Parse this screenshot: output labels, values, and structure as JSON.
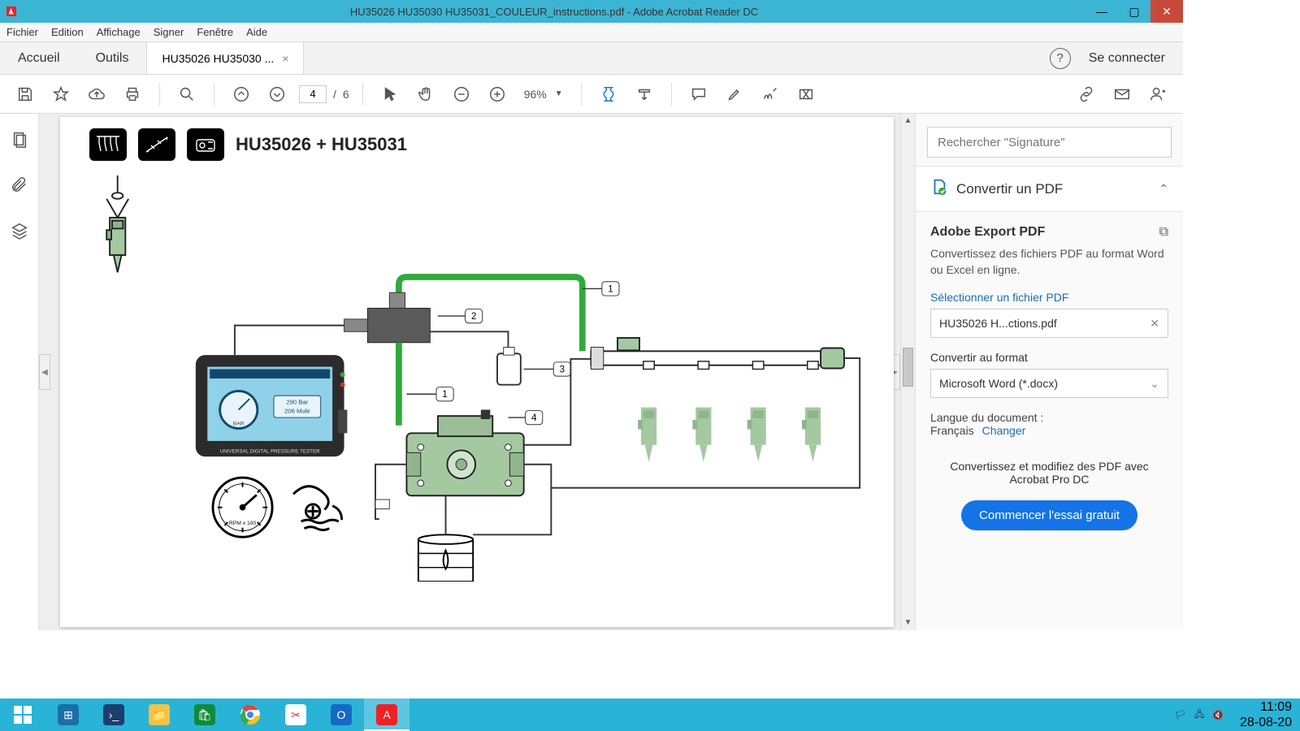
{
  "window": {
    "title": "HU35026 HU35030 HU35031_COULEUR_instructions.pdf - Adobe Acrobat Reader DC"
  },
  "menu": {
    "items": [
      "Fichier",
      "Edition",
      "Affichage",
      "Signer",
      "Fenêtre",
      "Aide"
    ]
  },
  "tabs": {
    "home": "Accueil",
    "tools": "Outils",
    "file": "HU35026 HU35030 ...",
    "signin": "Se connecter"
  },
  "toolbar": {
    "page_current": "4",
    "page_sep": "/",
    "page_total": "6",
    "zoom": "96%"
  },
  "document": {
    "heading": "HU35026 + HU35031",
    "callouts": [
      "1",
      "2",
      "3",
      "4",
      "1"
    ],
    "gauge_reading": [
      "290 Bar",
      "206 Mule"
    ],
    "tester_label": "UNIVERSAL DIGITAL PRESSURE TESTER"
  },
  "rightpanel": {
    "search_placeholder": "Rechercher \"Signature\"",
    "convert_title": "Convertir un PDF",
    "export_title": "Adobe Export PDF",
    "export_desc": "Convertissez des fichiers PDF au format Word ou Excel en ligne.",
    "select_label": "Sélectionner un fichier PDF",
    "selected_file": "HU35026 H...ctions.pdf",
    "format_label": "Convertir au format",
    "format_value": "Microsoft Word (*.docx)",
    "lang_label": "Langue du document :",
    "lang_value": "Français",
    "lang_change": "Changer",
    "promo": "Convertissez et modifiez des PDF avec Acrobat Pro DC",
    "cta": "Commencer l'essai gratuit"
  },
  "taskbar": {
    "time": "11:09",
    "date": "28-08-20"
  }
}
